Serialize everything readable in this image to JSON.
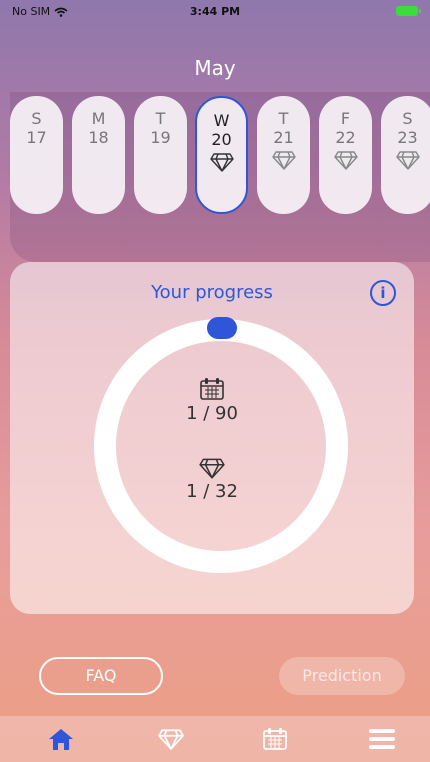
{
  "status_bar": {
    "carrier": "No SIM",
    "time": "3:44 PM"
  },
  "month": "May",
  "days": [
    {
      "name": "S",
      "date": "17",
      "gem": false,
      "active": false
    },
    {
      "name": "M",
      "date": "18",
      "gem": false,
      "active": false
    },
    {
      "name": "T",
      "date": "19",
      "gem": false,
      "active": false
    },
    {
      "name": "W",
      "date": "20",
      "gem": true,
      "active": true
    },
    {
      "name": "T",
      "date": "21",
      "gem": true,
      "active": false
    },
    {
      "name": "F",
      "date": "22",
      "gem": true,
      "active": false
    },
    {
      "name": "S",
      "date": "23",
      "gem": true,
      "active": false
    }
  ],
  "progress": {
    "title": "Your progress",
    "info_icon": "i",
    "days_value": "1  / 90",
    "gems_value": "1  / 32"
  },
  "buttons": {
    "faq": "FAQ",
    "prediction": "Prediction"
  },
  "tabs": [
    "home-icon",
    "diamond-icon",
    "calendar-icon",
    "menu-icon"
  ],
  "colors": {
    "accent": "#2f56d8",
    "active_tab": "#2f56d8",
    "inactive_tab": "#ffffff"
  }
}
